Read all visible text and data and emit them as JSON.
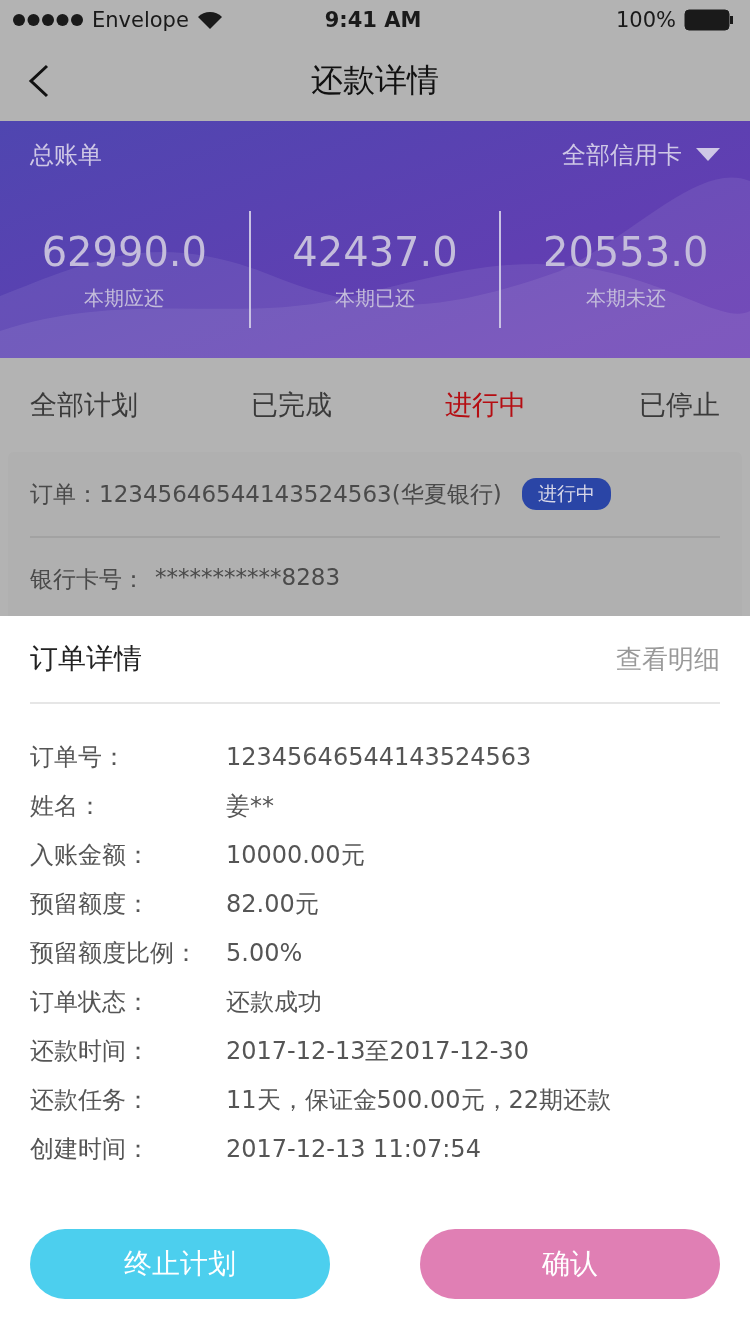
{
  "status_bar": {
    "carrier": "Envelope",
    "time": "9:41 AM",
    "battery": "100%"
  },
  "nav": {
    "title": "还款详情"
  },
  "summary": {
    "title": "总账单",
    "filter": "全部信用卡",
    "stats": [
      {
        "value": "62990.0",
        "label": "本期应还"
      },
      {
        "value": "42437.0",
        "label": "本期已还"
      },
      {
        "value": "20553.0",
        "label": "本期未还"
      }
    ]
  },
  "tabs": [
    {
      "label": "全部计划",
      "selected": false
    },
    {
      "label": "已完成",
      "selected": false
    },
    {
      "label": "进行中",
      "selected": true
    },
    {
      "label": "已停止",
      "selected": false
    }
  ],
  "order_card": {
    "order_label": "订单：",
    "order_text": "12345646544143524563(华夏银行)",
    "badge": "进行中",
    "card_label": "银行卡号：",
    "card_number": "***********8283"
  },
  "sheet": {
    "title": "订单详情",
    "link": "查看明细",
    "rows": [
      {
        "label": "订单号：",
        "value": "12345646544143524563"
      },
      {
        "label": "姓名：",
        "value": "姜**"
      },
      {
        "label": "入账金额：",
        "value": "10000.00元"
      },
      {
        "label": "预留额度：",
        "value": "82.00元"
      },
      {
        "label": "预留额度比例：",
        "value": "5.00%"
      },
      {
        "label": "订单状态：",
        "value": "还款成功"
      },
      {
        "label": "还款时间：",
        "value": "2017-12-13至2017-12-30"
      },
      {
        "label": "还款任务：",
        "value": "11天，保证金500.00元，22期还款"
      },
      {
        "label": "创建时间：",
        "value": "2017-12-13 11:07:54"
      }
    ],
    "buttons": [
      {
        "label": "终止计划",
        "kind": "stop"
      },
      {
        "label": "确认",
        "kind": "confirm"
      }
    ]
  }
}
